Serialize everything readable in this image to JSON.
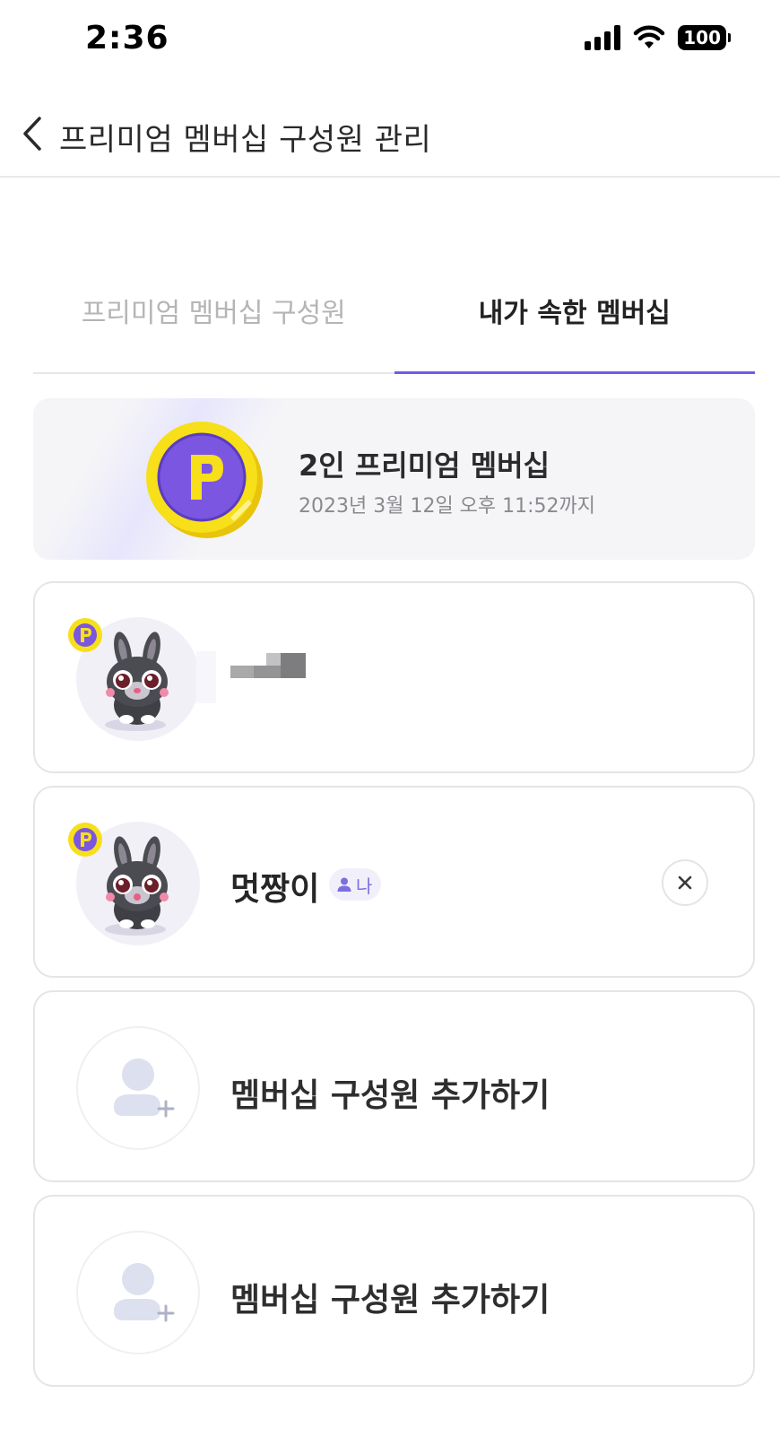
{
  "status_bar": {
    "time": "2:36",
    "battery": "100"
  },
  "header": {
    "title": "프리미엄 멤버십 구성원 관리",
    "back_icon": "chevron-left-icon"
  },
  "tabs": [
    {
      "label": "프리미엄 멤버십 구성원",
      "active": false
    },
    {
      "label": "내가 속한 멤버십",
      "active": true
    }
  ],
  "membership": {
    "title": "2인 프리미엄 멤버십",
    "expiry": "2023년 3월 12일 오후 11:52까지",
    "coin_letter": "P"
  },
  "members": [
    {
      "name": "",
      "premium": true
    },
    {
      "name": "멋짱이",
      "premium": true,
      "me_label": "나"
    }
  ],
  "add_slots": [
    {
      "label": "멤버십 구성원 추가하기"
    },
    {
      "label": "멤버십 구성원 추가하기"
    }
  ],
  "colors": {
    "accent": "#6e5ce6",
    "coin_gold": "#f5dc17",
    "coin_purple": "#7b56e0"
  }
}
